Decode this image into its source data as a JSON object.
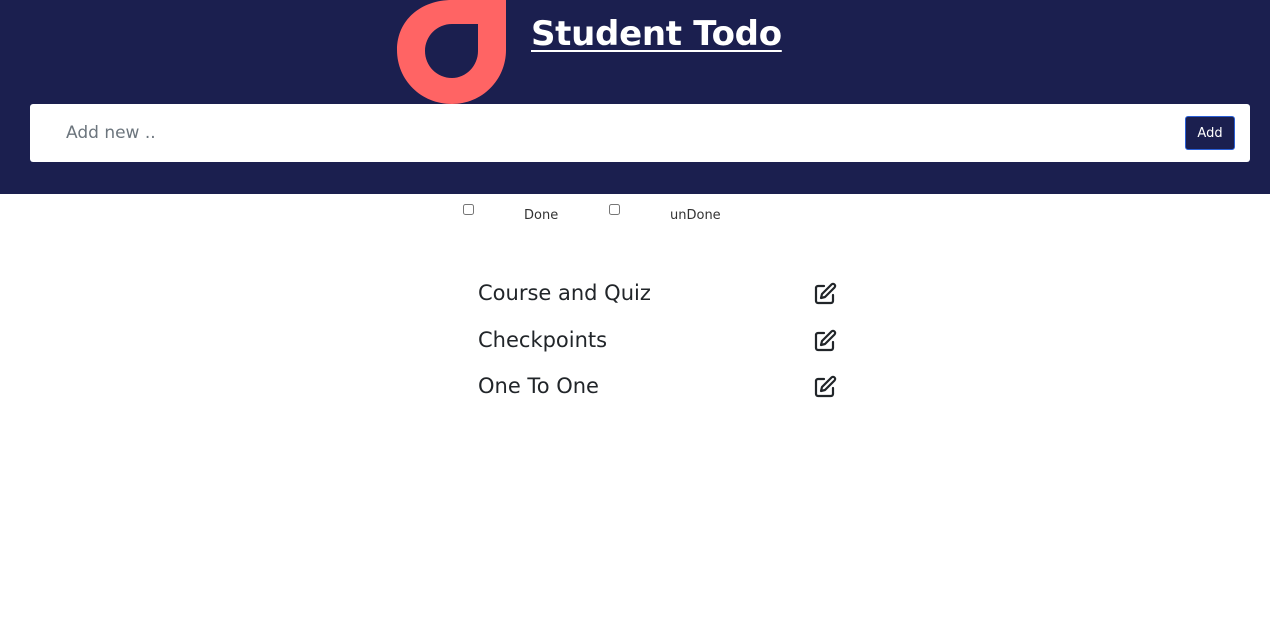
{
  "header": {
    "title": "Student Todo",
    "logo_icon": "droplet-logo-icon",
    "background_color": "#1b1f4f",
    "logo_color": "#ff6464"
  },
  "add_form": {
    "placeholder": "Add new ..",
    "value": "",
    "button_label": "Add"
  },
  "filters": [
    {
      "label": "Done",
      "checked": false
    },
    {
      "label": "unDone",
      "checked": false
    }
  ],
  "todos": [
    {
      "text": "Course and Quiz",
      "action_icon": "edit-icon"
    },
    {
      "text": "Checkpoints",
      "action_icon": "edit-icon"
    },
    {
      "text": "One To One",
      "action_icon": "edit-icon"
    }
  ]
}
